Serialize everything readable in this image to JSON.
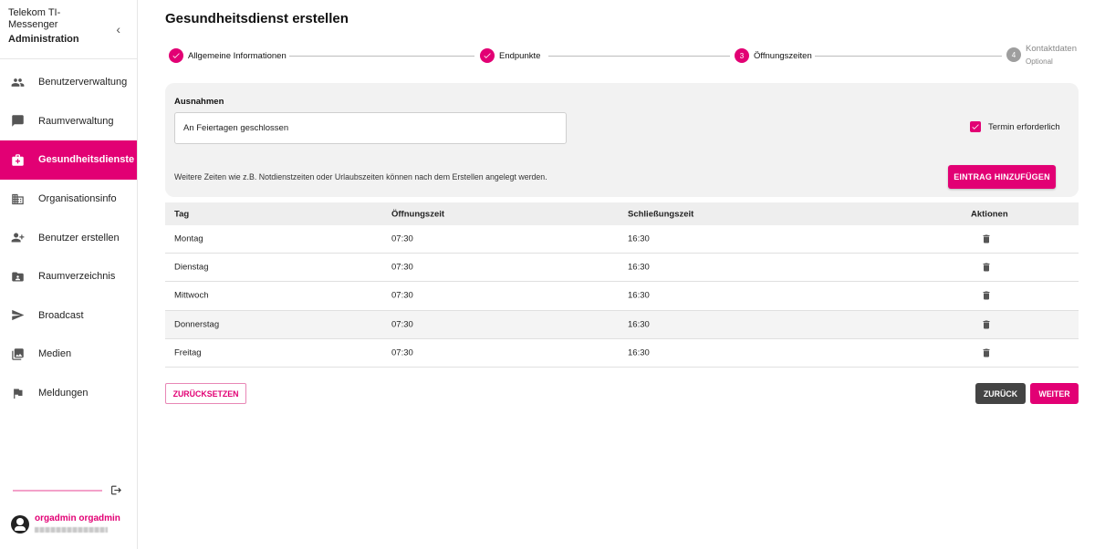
{
  "sidebar": {
    "app_name": "Telekom TI-Messenger",
    "role": "Administration",
    "items": [
      {
        "label": "Benutzerverwaltung",
        "icon": "people-icon",
        "active": false
      },
      {
        "label": "Raumverwaltung",
        "icon": "chat-icon",
        "active": false
      },
      {
        "label": "Gesundheitsdienste",
        "icon": "medical-bag-icon",
        "active": true
      },
      {
        "label": "Organisationsinfo",
        "icon": "building-icon",
        "active": false
      },
      {
        "label": "Benutzer erstellen",
        "icon": "person-add-icon",
        "active": false
      },
      {
        "label": "Raumverzeichnis",
        "icon": "folder-person-icon",
        "active": false
      },
      {
        "label": "Broadcast",
        "icon": "send-icon",
        "active": false
      },
      {
        "label": "Medien",
        "icon": "images-icon",
        "active": false
      },
      {
        "label": "Meldungen",
        "icon": "flag-icon",
        "active": false
      }
    ],
    "user": {
      "name": "orgadmin orgadmin"
    }
  },
  "page": {
    "title": "Gesundheitsdienst erstellen"
  },
  "stepper": {
    "steps": [
      {
        "label": "Allgemeine Informationen",
        "state": "done"
      },
      {
        "label": "Endpunkte",
        "state": "done"
      },
      {
        "label": "Öffnungszeiten",
        "number": "3",
        "state": "active"
      },
      {
        "label": "Kontaktdaten",
        "sublabel": "Optional",
        "number": "4",
        "state": "upcoming"
      }
    ]
  },
  "exceptions": {
    "label": "Ausnahmen",
    "input_value": "An Feiertagen geschlossen",
    "checkbox_label": "Termin erforderlich",
    "checkbox_checked": true,
    "hint": "Weitere Zeiten wie z.B. Notdienstzeiten oder Urlaubszeiten können nach dem Erstellen angelegt werden.",
    "add_button": "EINTRAG HINZUFÜGEN"
  },
  "table": {
    "headers": [
      "Tag",
      "Öffnungszeit",
      "Schließungszeit",
      "Aktionen"
    ],
    "rows": [
      {
        "day": "Montag",
        "open": "07:30",
        "close": "16:30"
      },
      {
        "day": "Dienstag",
        "open": "07:30",
        "close": "16:30"
      },
      {
        "day": "Mittwoch",
        "open": "07:30",
        "close": "16:30"
      },
      {
        "day": "Donnerstag",
        "open": "07:30",
        "close": "16:30"
      },
      {
        "day": "Freitag",
        "open": "07:30",
        "close": "16:30"
      }
    ]
  },
  "actions": {
    "reset": "ZURÜCKSETZEN",
    "back": "ZURÜCK",
    "next": "WEITER"
  },
  "colors": {
    "accent": "#e20074",
    "dark_button": "#444444"
  }
}
